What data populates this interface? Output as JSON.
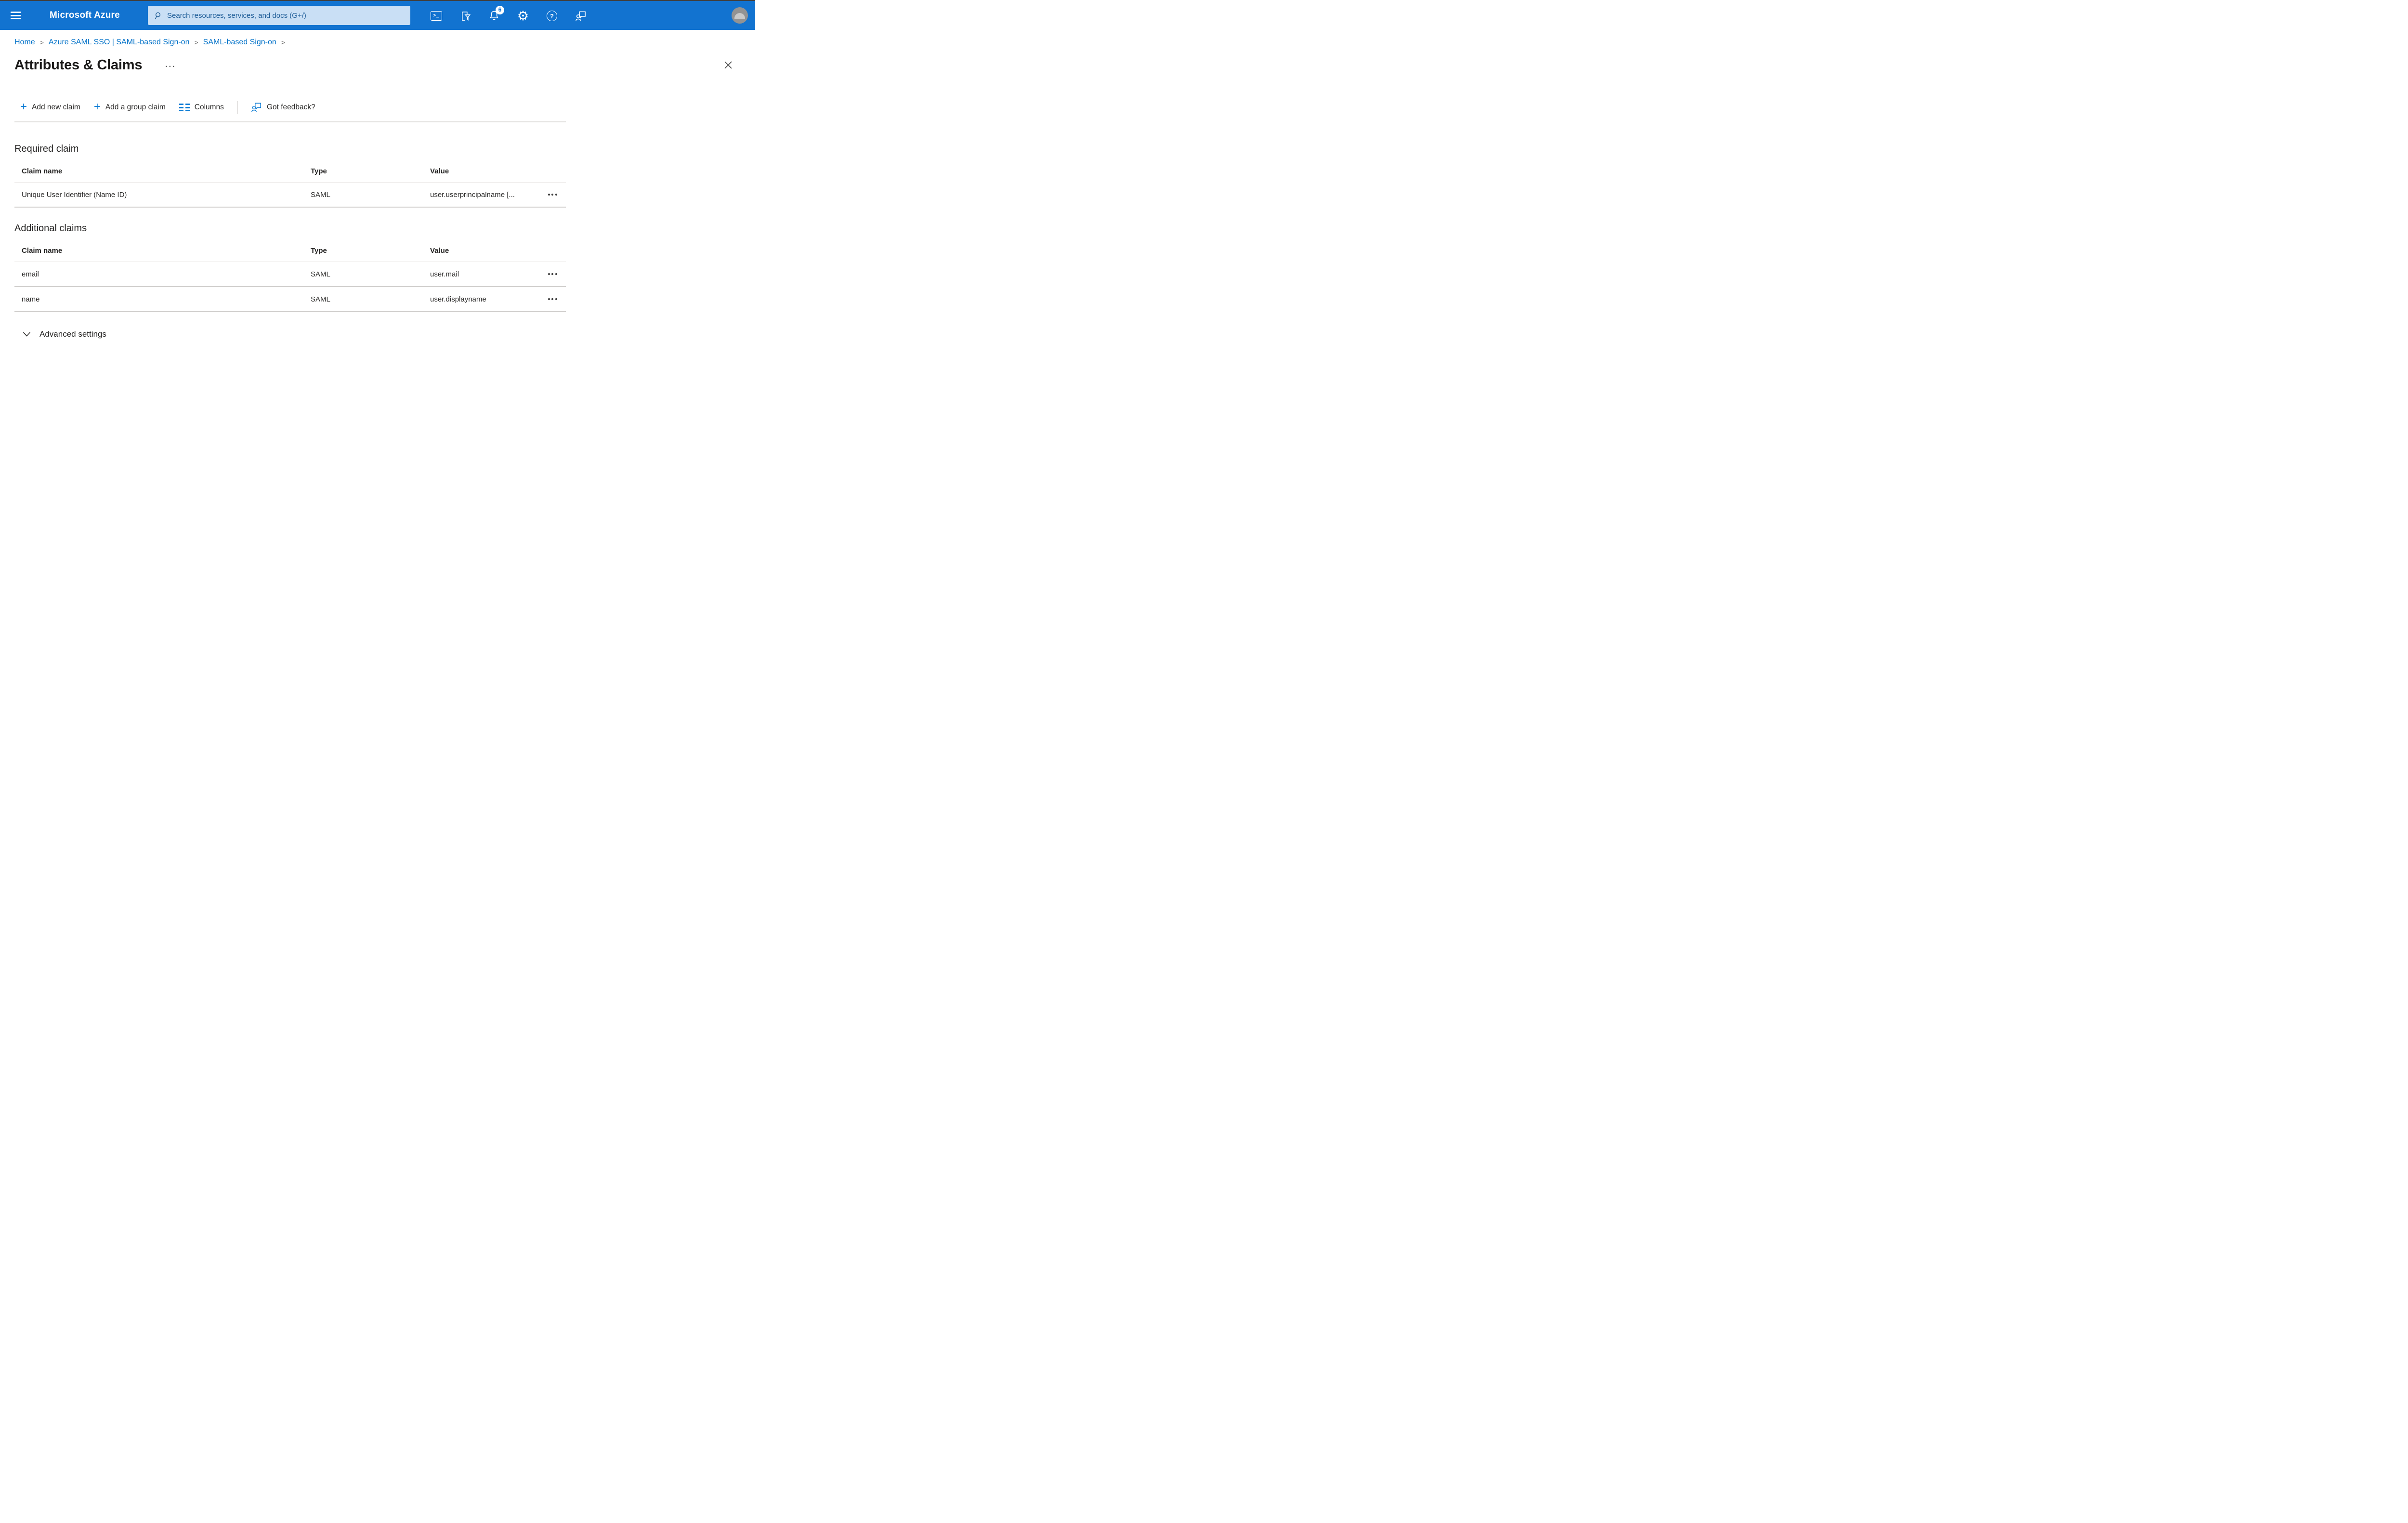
{
  "colors": {
    "topbar_blue": "#1273d0",
    "accent_blue": "#0b7bd4",
    "link_blue": "#0071c8",
    "search_fill": "#c9dff5",
    "search_text": "#1d5c97"
  },
  "icons": {
    "terminal_glyph": ">_",
    "gear_glyph": "⚙",
    "help_glyph": "?",
    "plus_glyph": "+",
    "title_menu_glyph": "···"
  },
  "topbar": {
    "brand": "Microsoft Azure",
    "search_placeholder": "Search resources, services, and docs (G+/)",
    "notification_count": "6"
  },
  "breadcrumb": {
    "separator": ">",
    "items": [
      {
        "label": "Home"
      },
      {
        "label": "Azure SAML SSO | SAML-based Sign-on"
      },
      {
        "label": "SAML-based Sign-on"
      }
    ]
  },
  "page": {
    "title": "Attributes & Claims"
  },
  "toolbar": {
    "buttons": [
      {
        "label": "Add new claim"
      },
      {
        "label": "Add a group claim"
      },
      {
        "label": "Columns"
      },
      {
        "label": "Got feedback?"
      }
    ]
  },
  "required_claim": {
    "heading": "Required claim",
    "columns": [
      "Claim name",
      "Type",
      "Value"
    ],
    "rows": [
      {
        "claim_name": "Unique User Identifier (Name ID)",
        "type": "SAML",
        "value": "user.userprincipalname [..."
      }
    ]
  },
  "additional_claims": {
    "heading": "Additional claims",
    "columns": [
      "Claim name",
      "Type",
      "Value"
    ],
    "rows": [
      {
        "claim_name": "email",
        "type": "SAML",
        "value": "user.mail"
      },
      {
        "claim_name": "name",
        "type": "SAML",
        "value": "user.displayname"
      }
    ]
  },
  "advanced": {
    "label": "Advanced settings"
  }
}
